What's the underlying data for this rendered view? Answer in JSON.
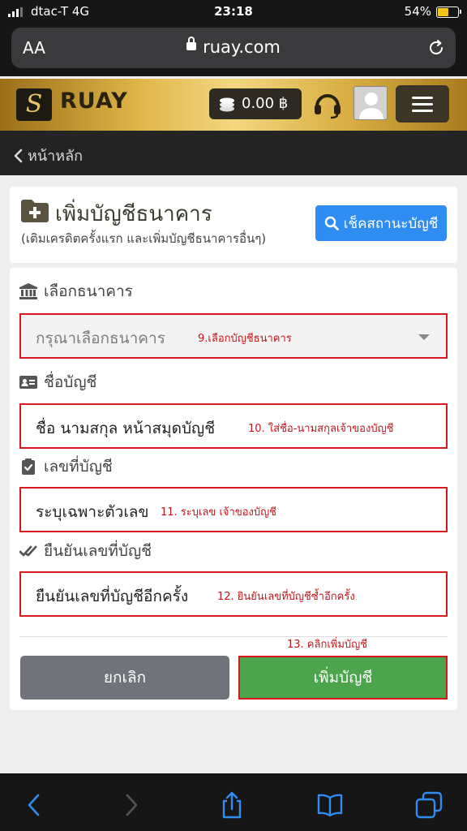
{
  "status_bar": {
    "carrier": "dtac-T",
    "network": "4G",
    "time": "23:18",
    "battery_percent": "54%",
    "battery_level": 0.54,
    "battery_color": "#f5c518"
  },
  "browser": {
    "text_size_label": "AA",
    "domain": "ruay.com",
    "icons": [
      "lock-icon",
      "reload-icon"
    ]
  },
  "header": {
    "logo_letter": "S",
    "brand": "RUAY",
    "balance": "0.00 ฿",
    "accent_color": "#e0b64a",
    "icons": [
      "coins-icon",
      "headset-icon",
      "avatar-icon",
      "hamburger-menu-icon"
    ]
  },
  "nav": {
    "back_label": "หน้าหลัก"
  },
  "page": {
    "title": "เพิ่มบัญชีธนาคาร",
    "subtitle": "(เติมเครดิตครั้งแรก และเพิ่มบัญชีธนาคารอื่นๆ)",
    "check_status_button": "เช็คสถานะบัญชี",
    "check_button_color": "#2f8cf1"
  },
  "form": {
    "bank": {
      "label": "เลือกธนาคาร",
      "placeholder": "กรุณาเลือกธนาคาร",
      "annotation": "9.เลือกบัญชีธนาคาร"
    },
    "account_name": {
      "label": "ชื่อบัญชี",
      "placeholder": "ชื่อ นามสกุล หน้าสมุดบัญชี",
      "annotation": "10. ใส่ชื่อ-นามสกุลเจ้าของบัญชี"
    },
    "account_number": {
      "label": "เลขที่บัญชี",
      "placeholder": "ระบุเฉพาะตัวเลข",
      "annotation": "11. ระบุเลข เจ้าของบัญชี"
    },
    "confirm_number": {
      "label": "ยืนยันเลขที่บัญชี",
      "placeholder": "ยืนยันเลขที่บัญชีอีกครั้ง",
      "annotation": "12. ยินยันเลขที่บัญชีซ้ำอีกครั้ง"
    },
    "submit_annotation": "13. คลิกเพิ่มบัญชี",
    "cancel_button": "ยกเลิก",
    "add_button": "เพิ่มบัญชี",
    "add_button_color": "#4ca54c",
    "annotation_color": "#d81820"
  },
  "toolbar": {
    "icons": [
      "back-icon",
      "forward-icon",
      "share-icon",
      "bookmarks-icon",
      "tabs-icon"
    ]
  }
}
